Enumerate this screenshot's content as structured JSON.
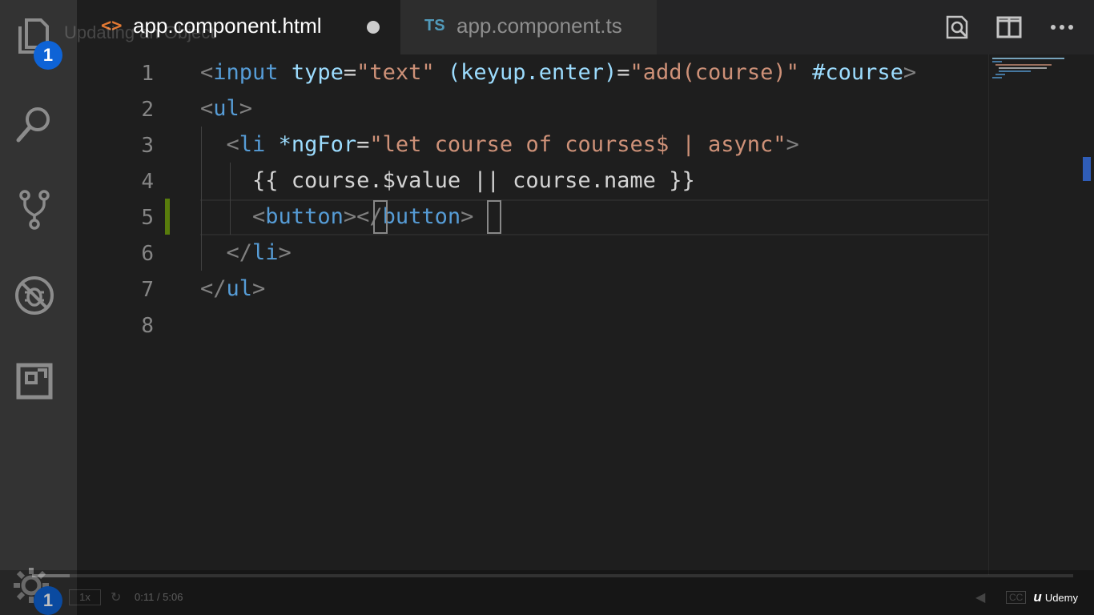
{
  "overlay": {
    "title": "Updating an Object"
  },
  "activity_bar": {
    "explorer_badge": "1",
    "settings_badge": "1"
  },
  "tabs": [
    {
      "icon": "<>",
      "label": "app.component.html",
      "dirty": true,
      "active": true
    },
    {
      "icon": "TS",
      "label": "app.component.ts",
      "dirty": false,
      "active": false
    }
  ],
  "editor": {
    "line_numbers": [
      "1",
      "2",
      "3",
      "4",
      "5",
      "6",
      "7",
      "8"
    ],
    "lines": [
      [
        {
          "t": "<",
          "c": "t-punc"
        },
        {
          "t": "input",
          "c": "t-tag"
        },
        {
          "t": " "
        },
        {
          "t": "type",
          "c": "t-attr"
        },
        {
          "t": "=",
          "c": "t-plain"
        },
        {
          "t": "\"text\"",
          "c": "t-str"
        },
        {
          "t": " "
        },
        {
          "t": "(keyup.enter)",
          "c": "t-attr"
        },
        {
          "t": "=",
          "c": "t-plain"
        },
        {
          "t": "\"add(course)\"",
          "c": "t-str"
        },
        {
          "t": " "
        },
        {
          "t": "#course",
          "c": "t-attr"
        },
        {
          "t": ">",
          "c": "t-punc"
        }
      ],
      [
        {
          "t": "<",
          "c": "t-punc"
        },
        {
          "t": "ul",
          "c": "t-tag"
        },
        {
          "t": ">",
          "c": "t-punc"
        }
      ],
      [
        {
          "t": "  "
        },
        {
          "t": "<",
          "c": "t-punc"
        },
        {
          "t": "li",
          "c": "t-tag"
        },
        {
          "t": " "
        },
        {
          "t": "*ngFor",
          "c": "t-attr"
        },
        {
          "t": "=",
          "c": "t-plain"
        },
        {
          "t": "\"let course of courses$ | async\"",
          "c": "t-str"
        },
        {
          "t": ">",
          "c": "t-punc"
        }
      ],
      [
        {
          "t": "    {{ course.$value || course.name }}",
          "c": "t-plain"
        }
      ],
      [
        {
          "t": "    "
        },
        {
          "t": "<",
          "c": "t-punc"
        },
        {
          "t": "button",
          "c": "t-tag"
        },
        {
          "t": ">",
          "c": "t-punc"
        },
        {
          "t": "</",
          "c": "t-punc"
        },
        {
          "t": "button",
          "c": "t-tag"
        },
        {
          "t": ">",
          "c": "t-punc"
        }
      ],
      [
        {
          "t": "  "
        },
        {
          "t": "</",
          "c": "t-punc"
        },
        {
          "t": "li",
          "c": "t-tag"
        },
        {
          "t": ">",
          "c": "t-punc"
        }
      ],
      [
        {
          "t": "</",
          "c": "t-punc"
        },
        {
          "t": "ul",
          "c": "t-tag"
        },
        {
          "t": ">",
          "c": "t-punc"
        }
      ],
      []
    ],
    "current_line": "5"
  },
  "player": {
    "speed": "1x",
    "time": "0:11 / 5:06",
    "progress": 0.036,
    "brand": "Udemy"
  },
  "colors": {
    "activity_bar": "#333333",
    "editor_bg": "#1e1e1e",
    "tag": "#569cd6",
    "attribute": "#9cdcfe",
    "string": "#ce9178",
    "badge": "#0e63d6",
    "modified_gutter": "#587c0c"
  },
  "icons": {
    "activity": [
      "files-icon",
      "search-icon",
      "source-control-icon",
      "debug-icon",
      "extensions-icon",
      "gear-icon"
    ],
    "editor_actions": [
      "open-preview-icon",
      "split-editor-icon",
      "more-actions-icon"
    ]
  }
}
